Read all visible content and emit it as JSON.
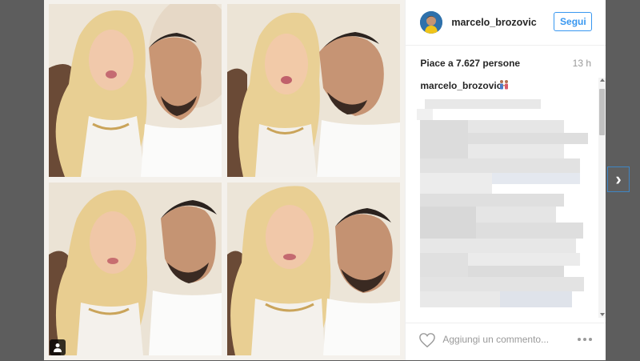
{
  "post": {
    "username": "marcelo_brozovic",
    "follow_label": "Segui",
    "likes_text": "Piace a 7.627 persone",
    "time_ago": "13 h",
    "caption_username": "marcelo_brozovic",
    "comment_placeholder": "Aggiungi un commento..."
  },
  "icons": {
    "user_tag": "user-tag-icon",
    "heart": "heart-icon",
    "more": "more-options-icon",
    "next": "chevron-right-icon",
    "caption_emoji": "couple-emoji-icon"
  },
  "colors": {
    "accent": "#3897f0",
    "text": "#262626",
    "muted": "#999999",
    "overlay": "#5d5d5d"
  }
}
